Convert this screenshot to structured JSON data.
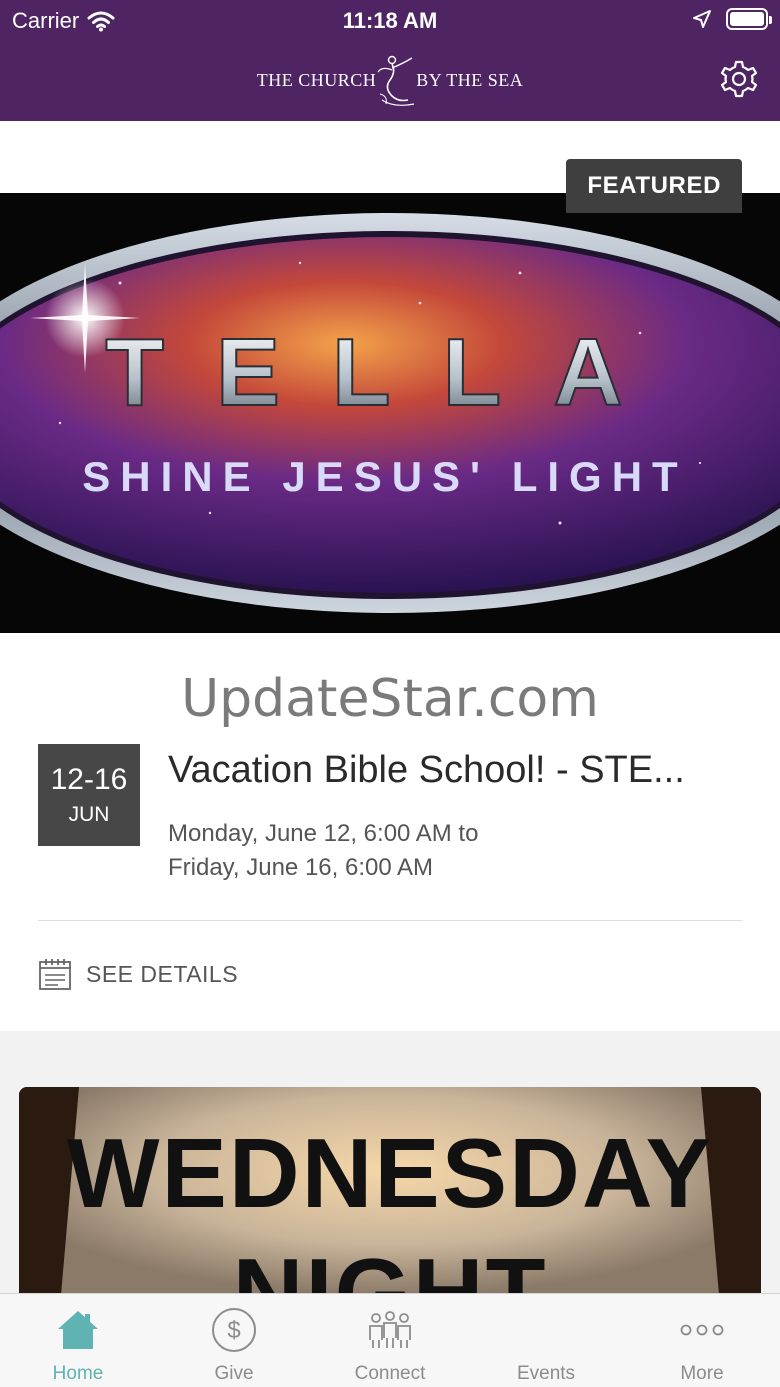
{
  "status_bar": {
    "carrier": "Carrier",
    "time": "11:18 AM"
  },
  "header": {
    "logo_left": "THE CHURCH",
    "logo_right": "BY THE SEA"
  },
  "featured": {
    "badge": "FEATURED",
    "banner_word": "TELLA",
    "banner_tagline": "SHINE JESUS' LIGHT",
    "watermark": "UpdateStar.com",
    "date_range": "12-16",
    "date_month": "JUN",
    "title": "Vacation Bible School! - STE...",
    "dates_line1": "Monday, June 12, 6:00 AM to",
    "dates_line2": "Friday, June 16, 6:00 AM",
    "details_label": "SEE DETAILS"
  },
  "second_card": {
    "banner_word1": "WEDNESDAY",
    "banner_word2": "NIGHT"
  },
  "tabs": [
    {
      "label": "Home",
      "icon": "home-icon",
      "active": true
    },
    {
      "label": "Give",
      "icon": "dollar-icon",
      "active": false
    },
    {
      "label": "Connect",
      "icon": "people-icon",
      "active": false
    },
    {
      "label": "Events",
      "icon": "calendar-icon",
      "active": false
    },
    {
      "label": "More",
      "icon": "more-icon",
      "active": false
    }
  ],
  "colors": {
    "header_bg": "#4e2463",
    "tab_active": "#5fb3b3",
    "badge_bg": "#3f3f3f"
  }
}
